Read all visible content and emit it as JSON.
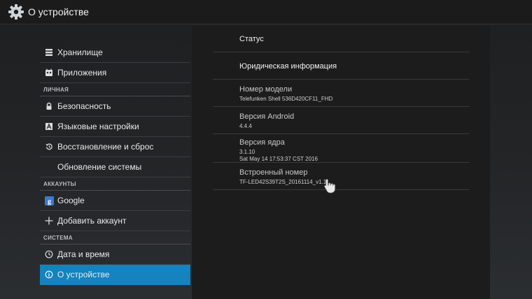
{
  "header": {
    "title": "О устройстве",
    "icon": "gear-icon"
  },
  "sidebar": {
    "items": [
      {
        "type": "item",
        "name": "storage",
        "icon": "storage-icon",
        "label": "Хранилище"
      },
      {
        "type": "item",
        "name": "apps",
        "icon": "apps-icon",
        "label": "Приложения"
      },
      {
        "type": "header",
        "name": "personal",
        "label": "ЛИЧНАЯ"
      },
      {
        "type": "item",
        "name": "security",
        "icon": "lock-icon",
        "label": "Безопасность"
      },
      {
        "type": "item",
        "name": "language",
        "icon": "language-icon",
        "label": "Языковые настройки"
      },
      {
        "type": "item",
        "name": "backup-reset",
        "icon": "restore-icon",
        "label": "Восстановление и сброс"
      },
      {
        "type": "item",
        "name": "system-update",
        "icon": "",
        "label": "Обновление системы"
      },
      {
        "type": "header",
        "name": "accounts",
        "label": "АККАУНТЫ"
      },
      {
        "type": "item",
        "name": "google",
        "icon": "google-icon",
        "label": "Google"
      },
      {
        "type": "item",
        "name": "add-account",
        "icon": "plus-icon",
        "label": "Добавить аккаунт"
      },
      {
        "type": "header",
        "name": "system",
        "label": "СИСТЕМА"
      },
      {
        "type": "item",
        "name": "date-time",
        "icon": "clock-icon",
        "label": "Дата и время"
      },
      {
        "type": "item",
        "name": "about-device",
        "icon": "info-icon",
        "label": "О устройстве",
        "selected": true
      }
    ]
  },
  "content": {
    "items": [
      {
        "name": "status",
        "title": "Статус"
      },
      {
        "name": "legal-info",
        "title": "Юридическая информация"
      },
      {
        "name": "model-number",
        "title": "Номер модели",
        "lines": [
          "Telefunken Shell 536D420CF11_FHD"
        ]
      },
      {
        "name": "android-version",
        "title": "Версия Android",
        "lines": [
          "4.4.4"
        ]
      },
      {
        "name": "kernel-version",
        "title": "Версия ядра",
        "lines": [
          "3.1.10",
          "Sat May 14 17:53:37 CST 2016"
        ]
      },
      {
        "name": "build-number",
        "title": "Встроенный номер",
        "lines": [
          "TF-LED42S39T2S_20161114_v1.1"
        ]
      }
    ]
  },
  "colors": {
    "accent": "#1483be",
    "google": "#3b7ad0"
  },
  "cursor_icon": "hand-pointer-icon"
}
